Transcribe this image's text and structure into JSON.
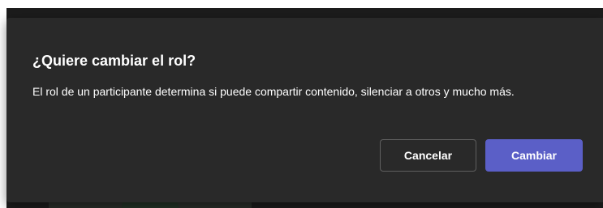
{
  "dialog": {
    "title": "¿Quiere cambiar el rol?",
    "body": "El rol de un participante determina si puede compartir contenido, silenciar a otros y mucho más.",
    "cancel_label": "Cancelar",
    "confirm_label": "Cambiar"
  },
  "colors": {
    "dialog_background": "#292929",
    "backdrop": "#1c1c1c",
    "primary_button": "#5b5fc7",
    "text": "#ffffff"
  }
}
